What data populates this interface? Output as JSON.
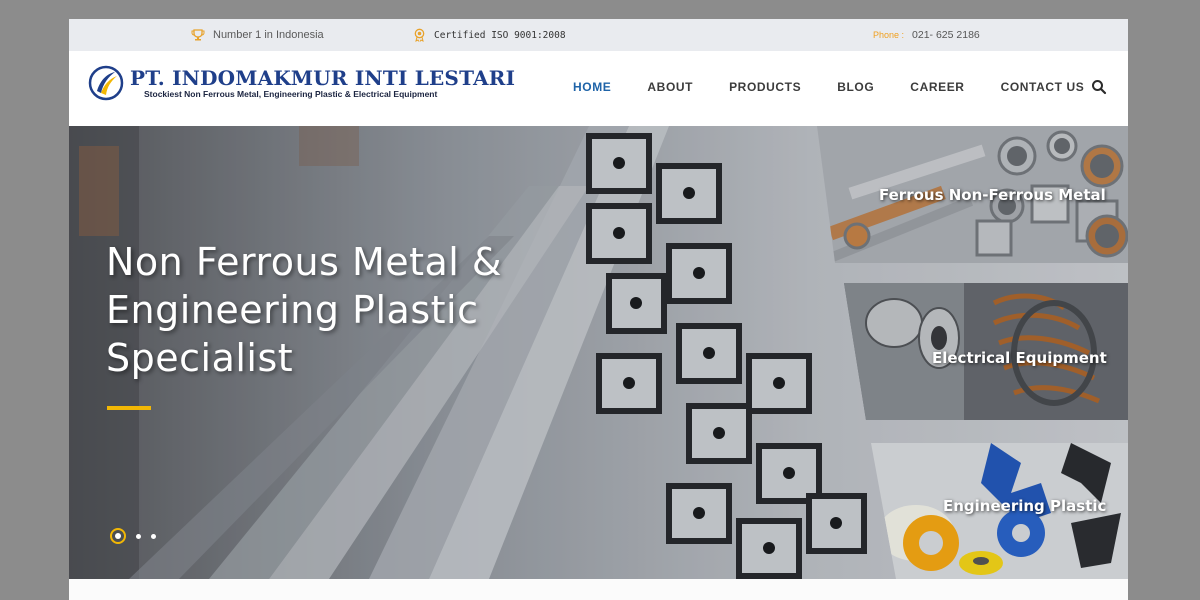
{
  "topbar": {
    "rank_text": "Number 1 in Indonesia",
    "iso_text": "Certified ISO 9001:2008",
    "phone_label": "Phone :",
    "phone_number": "021- 625 2186"
  },
  "brand": {
    "name": "PT. INDOMAKMUR INTI LESTARI",
    "tagline": "Stockiest Non Ferrous Metal, Engineering Plastic & Electrical Equipment"
  },
  "nav": {
    "items": [
      {
        "label": "HOME",
        "active": true
      },
      {
        "label": "ABOUT",
        "active": false
      },
      {
        "label": "PRODUCTS",
        "active": false
      },
      {
        "label": "BLOG",
        "active": false
      },
      {
        "label": "CAREER",
        "active": false
      },
      {
        "label": "CONTACT US",
        "active": false
      }
    ]
  },
  "hero": {
    "title": "Non Ferrous Metal &\nEngineering Plastic\nSpecialist",
    "slide_count": 3,
    "active_slide": 1
  },
  "categories": [
    {
      "label": "Ferrous Non-Ferrous Metal"
    },
    {
      "label": "Electrical Equipment"
    },
    {
      "label": "Engineering Plastic"
    }
  ],
  "colors": {
    "accent_blue": "#1e63a8",
    "accent_yellow": "#f2b705",
    "brand_navy": "#1f3f8a",
    "topbar_bg": "#e9ebef"
  },
  "icons": {
    "rank": "trophy-icon",
    "iso": "award-icon",
    "search": "search-icon"
  }
}
